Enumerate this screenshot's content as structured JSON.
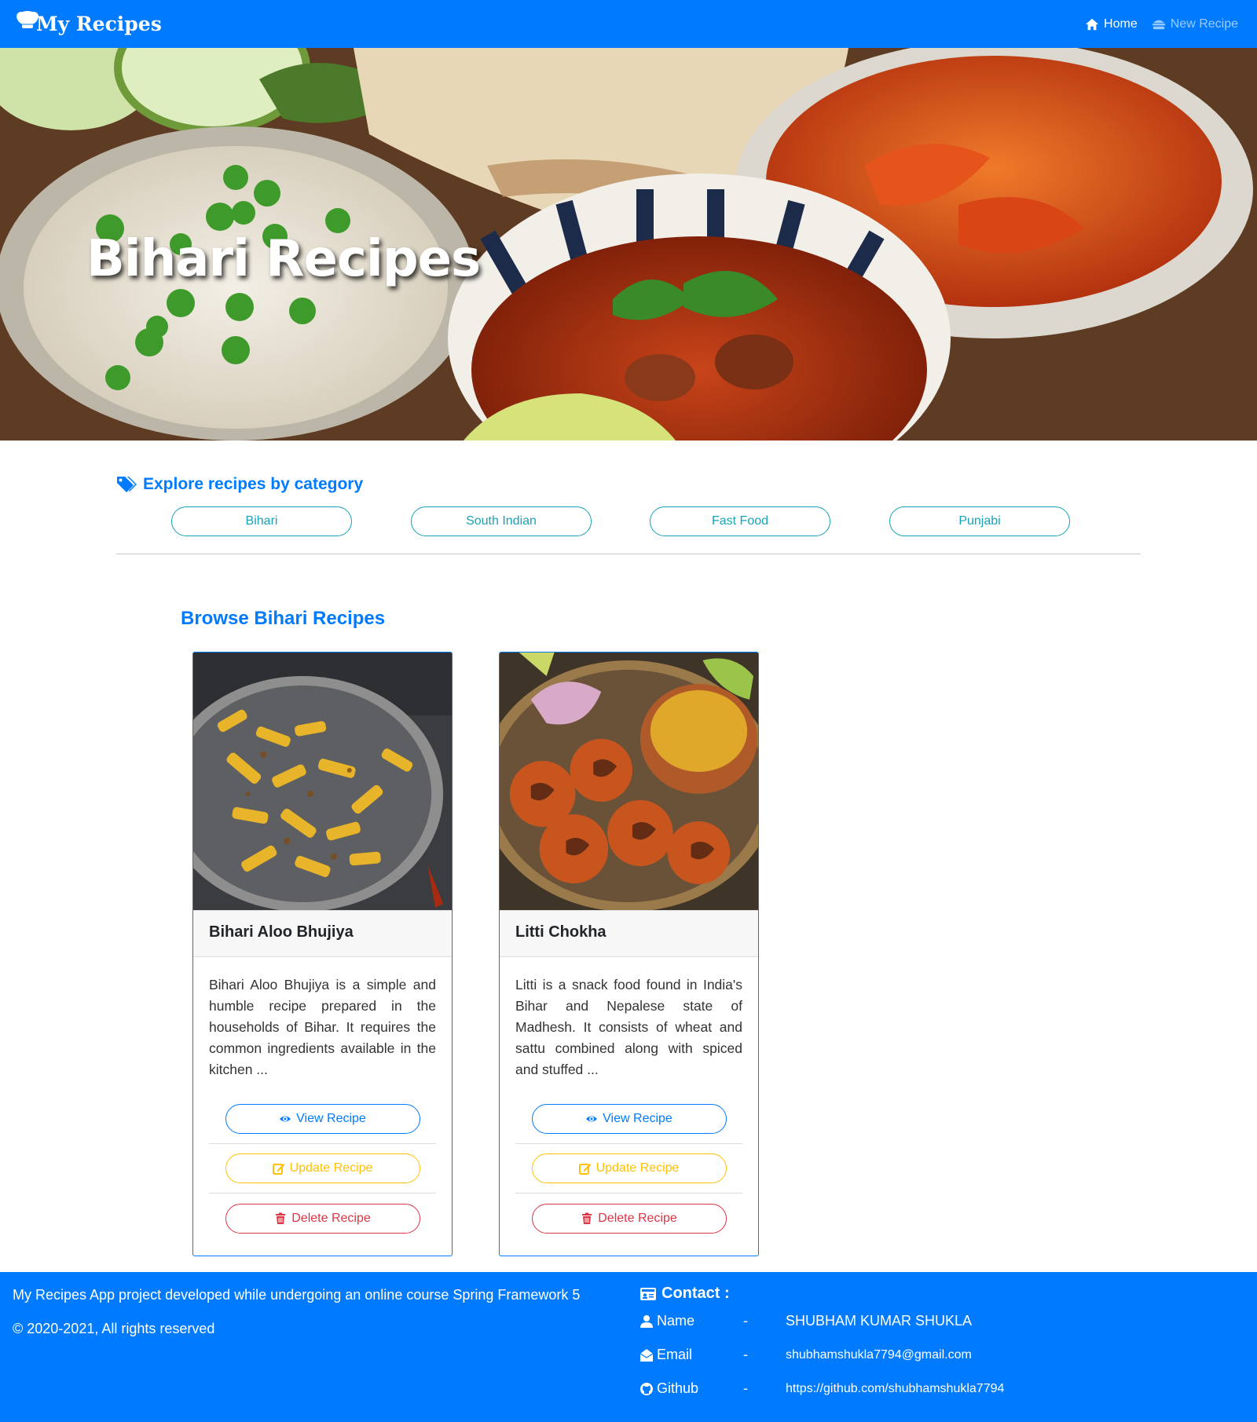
{
  "navbar": {
    "brand": "My Recipes",
    "links": [
      {
        "label": "Home",
        "icon": "home-icon"
      },
      {
        "label": "New Recipe",
        "icon": "hamburger-icon"
      }
    ]
  },
  "hero": {
    "title": "Bihari Recipes"
  },
  "category": {
    "heading": "Explore recipes by category",
    "items": [
      "Bihari",
      "South Indian",
      "Fast Food",
      "Punjabi"
    ]
  },
  "browse": {
    "title": "Browse Bihari Recipes",
    "cards": [
      {
        "title": "Bihari Aloo Bhujiya",
        "text": "Bihari Aloo Bhujiya is a simple and humble recipe prepared in the households of Bihar. It requires the common ingredients available in the kitchen ...",
        "view": "View Recipe",
        "update": "Update Recipe",
        "delete": "Delete Recipe"
      },
      {
        "title": "Litti Chokha",
        "text": "Litti is a snack food found in India's Bihar and Nepalese state of Madhesh. It consists of wheat and sattu combined along with spiced and stuffed ...",
        "view": "View Recipe",
        "update": "Update Recipe",
        "delete": "Delete Recipe"
      }
    ]
  },
  "footer": {
    "line1": "My Recipes App project developed while undergoing an online course Spring Framework 5",
    "line2": "© 2020-2021, All rights reserved",
    "contact": {
      "heading": "Contact :",
      "separator": "-",
      "rows": [
        {
          "label": "Name",
          "value": "SHUBHAM KUMAR SHUKLA"
        },
        {
          "label": "Email",
          "value": "shubhamshukla7794@gmail.com"
        },
        {
          "label": "Github",
          "value": "https://github.com/shubhamshukla7794"
        }
      ]
    }
  },
  "colors": {
    "primary": "#007bff",
    "info": "#17a2b8",
    "warning": "#ffc107",
    "danger": "#dc3545"
  }
}
